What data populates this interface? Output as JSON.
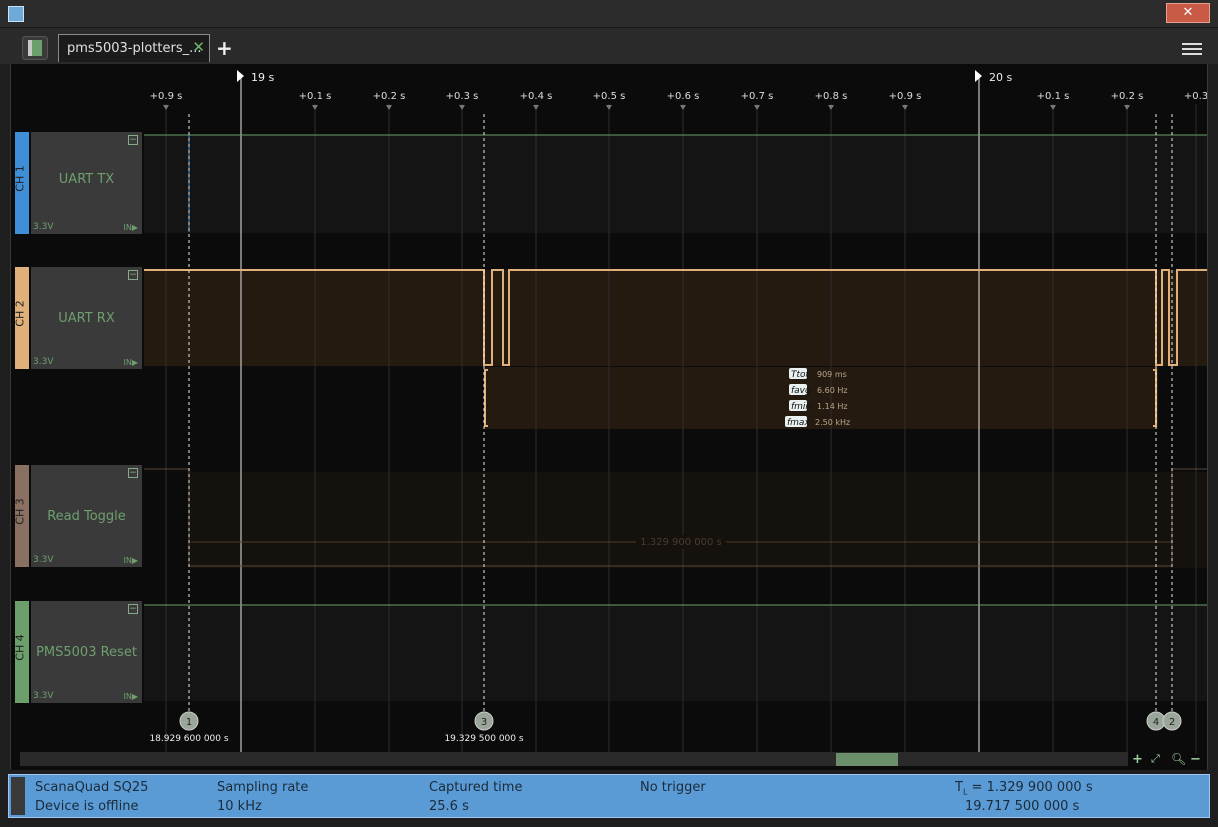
{
  "window": {
    "close_label": "✕"
  },
  "tab": {
    "title": "pms5003-plotters_...",
    "close": "✕",
    "add": "+"
  },
  "timeline": {
    "markers": [
      "19 s",
      "20 s"
    ],
    "ticks": [
      "+0.9 s",
      "+0.1 s",
      "+0.2 s",
      "+0.3 s",
      "+0.4 s",
      "+0.5 s",
      "+0.6 s",
      "+0.7 s",
      "+0.8 s",
      "+0.9 s",
      "+0.1 s",
      "+0.2 s",
      "+0.3"
    ]
  },
  "channels": [
    {
      "tab": "CH 1",
      "name": "UART TX",
      "voltage": "3.3V",
      "io": "IN",
      "color": "#3f8fd8"
    },
    {
      "tab": "CH 2",
      "name": "UART RX",
      "voltage": "3.3V",
      "io": "IN",
      "color": "#e0b07a"
    },
    {
      "tab": "CH 3",
      "name": "Read Toggle",
      "voltage": "3.3V",
      "io": "IN",
      "color": "#8a7060"
    },
    {
      "tab": "CH 4",
      "name": "PMS5003 Reset",
      "voltage": "3.3V",
      "io": "IN",
      "color": "#6b9f6b"
    }
  ],
  "measurements": [
    {
      "badge": "Ttot",
      "value": "909 ms"
    },
    {
      "badge": "favg",
      "value": "6.60 Hz"
    },
    {
      "badge": "fmin",
      "value": "1.14 Hz"
    },
    {
      "badge": "fmax",
      "value": "2.50 kHz"
    }
  ],
  "span_label": "1.329 900 000 s",
  "cursors": [
    {
      "id": "1",
      "time": "18.929 600 000 s"
    },
    {
      "id": "3",
      "time": "19.329 500 000 s"
    },
    {
      "id": "4",
      "time": ""
    },
    {
      "id": "2",
      "time": ""
    }
  ],
  "statusbar": {
    "device": "ScanaQuad SQ25",
    "device_state": "Device is offline",
    "sampling_label": "Sampling rate",
    "sampling_value": "10 kHz",
    "captured_label": "Captured time",
    "captured_value": "25.6 s",
    "trigger": "No trigger",
    "tl_label": "T",
    "tl_sub": "L",
    "tl_value": " = 1.329 900 000 s",
    "abs_time": "19.717 500 000 s"
  }
}
